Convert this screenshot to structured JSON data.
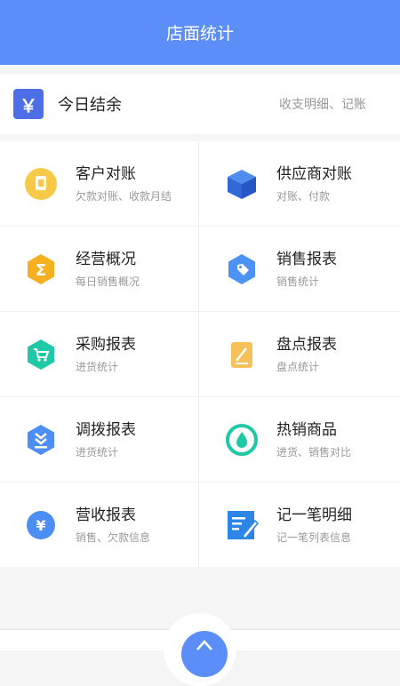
{
  "header": {
    "title": "店面统计"
  },
  "today": {
    "label": "今日结余",
    "link": "收支明细、记账",
    "yen_symbol": "￥",
    "chevron": ">"
  },
  "menu": [
    {
      "name": "customer-reconcile",
      "title": "客户对账",
      "sub": "欠款对账、收款月结",
      "icon": "coin-icon",
      "color": "#f7c948"
    },
    {
      "name": "supplier-reconcile",
      "title": "供应商对账",
      "sub": "对账、付款",
      "icon": "box-icon",
      "color": "#3e7be8"
    },
    {
      "name": "business-overview",
      "title": "经营概况",
      "sub": "每日销售概况",
      "icon": "sigma-icon",
      "color": "#f5b021"
    },
    {
      "name": "sales-report",
      "title": "销售报表",
      "sub": "销售统计",
      "icon": "tag-icon",
      "color": "#4c92f5"
    },
    {
      "name": "purchase-report",
      "title": "采购报表",
      "sub": "进货统计",
      "icon": "cart-icon",
      "color": "#1fc9a7"
    },
    {
      "name": "inventory-report",
      "title": "盘点报表",
      "sub": "盘点统计",
      "icon": "clipboard-icon",
      "color": "#f7c15a"
    },
    {
      "name": "transfer-report",
      "title": "调拨报表",
      "sub": "进货统计",
      "icon": "transfer-icon",
      "color": "#4c8ef5"
    },
    {
      "name": "hot-products",
      "title": "热销商品",
      "sub": "进货、销售对比",
      "icon": "flame-icon",
      "color": "#20c9a5"
    },
    {
      "name": "revenue-report",
      "title": "营收报表",
      "sub": "销售、欠款信息",
      "icon": "yen-circle-icon",
      "color": "#4c8ef5"
    },
    {
      "name": "bookkeeping-detail",
      "title": "记一笔明细",
      "sub": "记一笔列表信息",
      "icon": "note-pen-icon",
      "color": "#2d86e6"
    }
  ]
}
